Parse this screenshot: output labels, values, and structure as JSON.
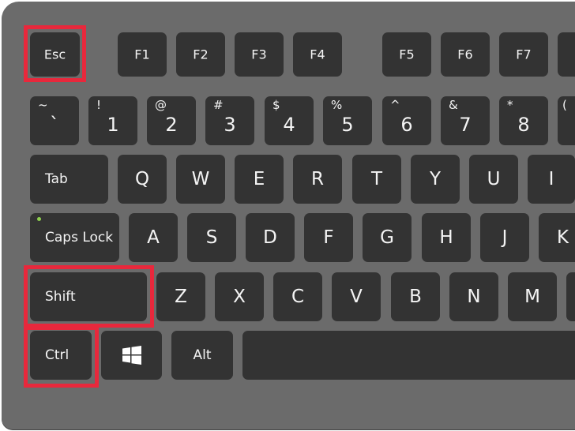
{
  "colors": {
    "body": "#6b6b6b",
    "key": "#333333",
    "highlight": "#e8283c",
    "caps_indicator": "#8fd14f"
  },
  "function_row": [
    "Esc",
    "F1",
    "F2",
    "F3",
    "F4",
    "F5",
    "F6",
    "F7"
  ],
  "number_row": [
    {
      "shift": "~",
      "main": "`"
    },
    {
      "shift": "!",
      "main": "1"
    },
    {
      "shift": "@",
      "main": "2"
    },
    {
      "shift": "#",
      "main": "3"
    },
    {
      "shift": "$",
      "main": "4"
    },
    {
      "shift": "%",
      "main": "5"
    },
    {
      "shift": "^",
      "main": "6"
    },
    {
      "shift": "&",
      "main": "7"
    },
    {
      "shift": "*",
      "main": "8"
    },
    {
      "shift": "(",
      "main": ""
    }
  ],
  "tab_row": [
    "Tab",
    "Q",
    "W",
    "E",
    "R",
    "T",
    "Y",
    "U",
    "I"
  ],
  "caps_row": [
    "Caps Lock",
    "A",
    "S",
    "D",
    "F",
    "G",
    "H",
    "J",
    "K"
  ],
  "shift_row": [
    "Shift",
    "Z",
    "X",
    "C",
    "V",
    "B",
    "N",
    "M"
  ],
  "bottom_row": {
    "ctrl": "Ctrl",
    "windows_icon": "windows-logo",
    "alt": "Alt"
  },
  "highlighted_keys": [
    "Esc",
    "Shift",
    "Ctrl"
  ]
}
